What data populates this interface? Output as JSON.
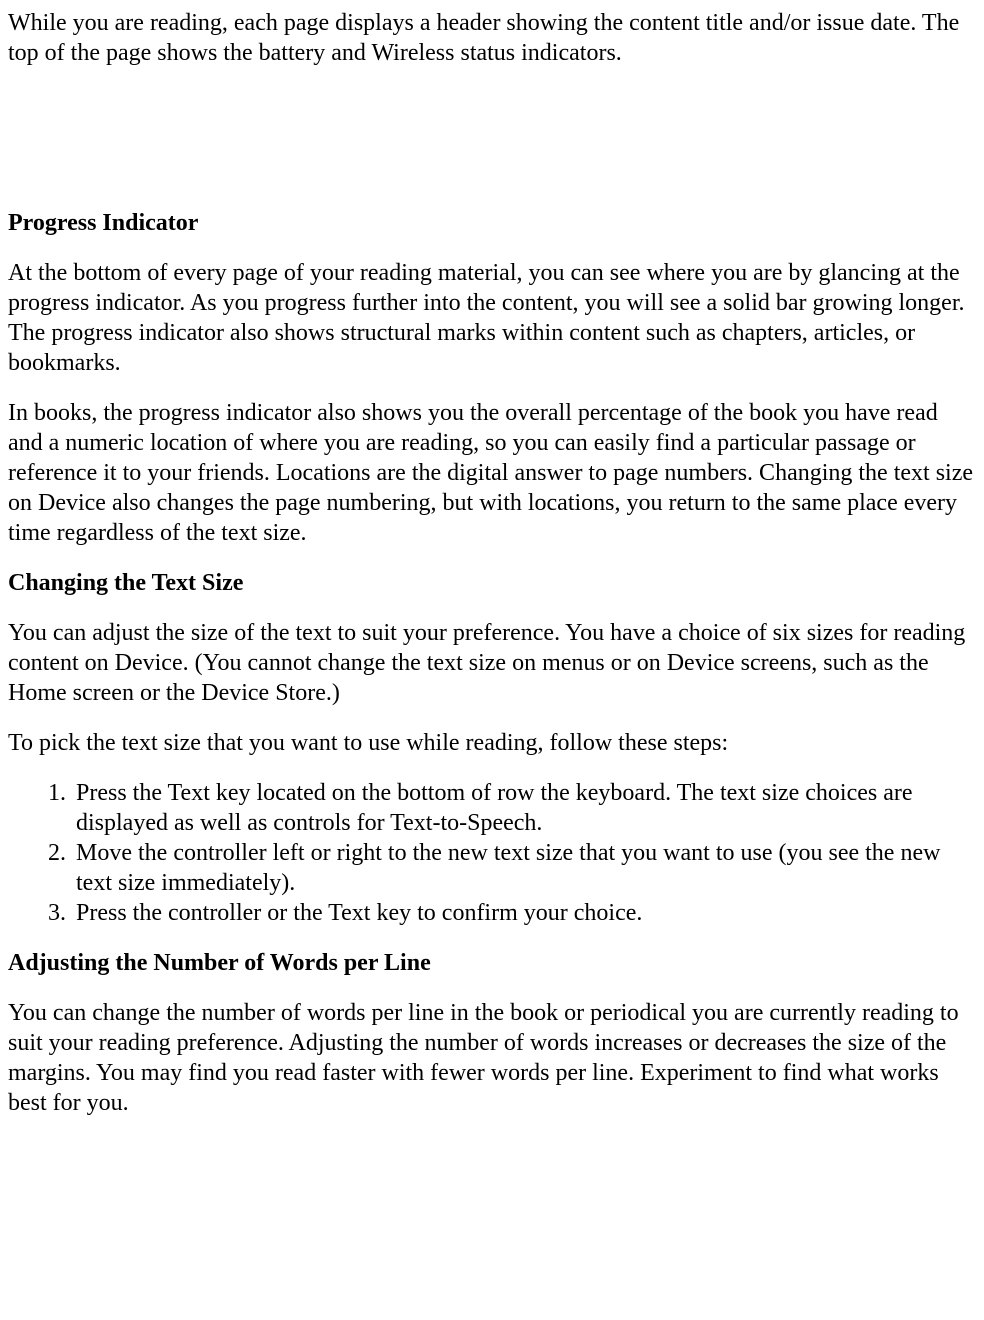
{
  "intro": "While you are reading, each page displays a header showing the content title and/or issue date. The top of the page shows the battery and Wireless status indicators.",
  "section1": {
    "heading": "Progress Indicator",
    "p1": "At the bottom of every page of your reading material, you can see where you are by glancing at the progress indicator. As you progress further into the content, you will see a solid bar growing longer. The progress indicator also shows structural marks within content such as chapters, articles, or bookmarks.",
    "p2": "In books, the progress indicator also shows you the overall percentage of the book you have read and a numeric location of where you are reading, so you can easily find a particular passage or reference it to your friends. Locations are the digital answer to page numbers. Changing the text size on Device also changes the page numbering, but with locations, you return to the same place every time regardless of the text size."
  },
  "section2": {
    "heading": "Changing the Text Size",
    "p1": "You can adjust the size of the text to suit your preference. You have a choice of six sizes for reading content on Device. (You cannot change the text size on menus or on Device screens, such as the Home screen or the Device Store.)",
    "p2": "To pick the text size that you want to use while reading, follow these steps:",
    "steps": [
      "Press the Text key located on the bottom of row the keyboard. The text size choices are displayed as well as controls for Text-to-Speech.",
      "Move the controller left or right to the new text size that you want to use (you see the new text size immediately).",
      "Press the controller or the Text key to confirm your choice."
    ]
  },
  "section3": {
    "heading": "Adjusting the Number of Words per Line",
    "p1": "You can change the number of words per line in the book or periodical you are currently reading to suit your reading preference. Adjusting the number of words increases or decreases the size of the margins. You may find you read faster with fewer words per line. Experiment to find what works best for you."
  }
}
